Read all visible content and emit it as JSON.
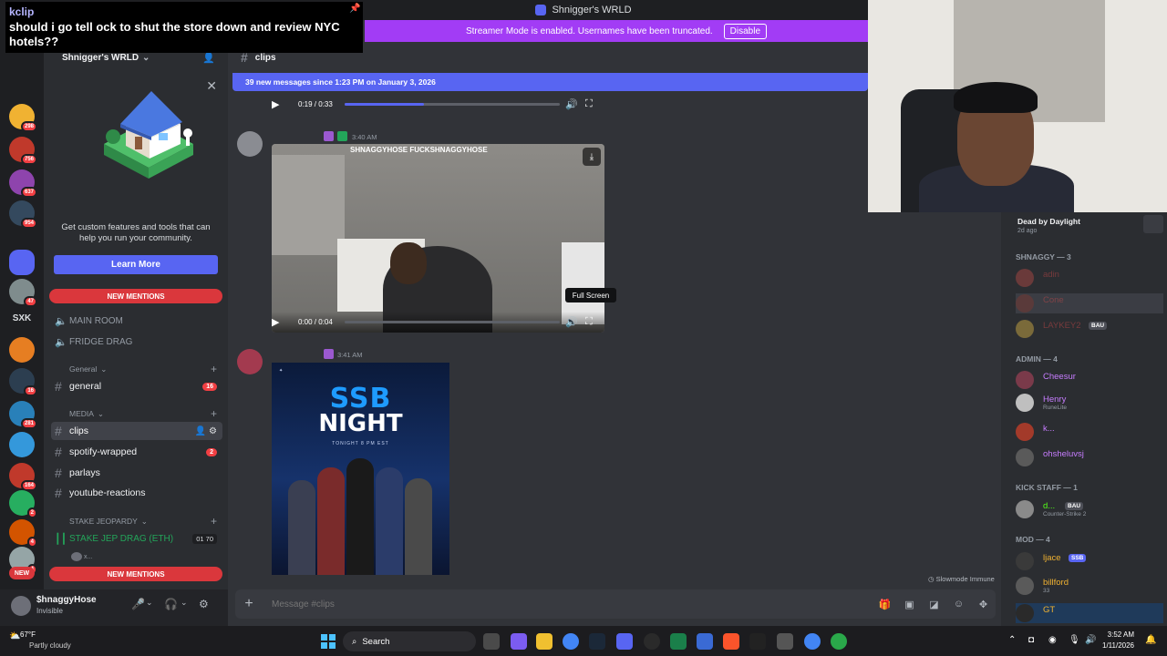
{
  "window": {
    "title": "Shnigger's WRLD"
  },
  "banner": {
    "text": "Streamer Mode is enabled. Usernames have been truncated.",
    "button": "Disable"
  },
  "overlay": {
    "user": "kclip",
    "message": "should i go tell ock to shut the store down and review NYC hotels??"
  },
  "server": {
    "name": "Shnigger's WRLD"
  },
  "rail": {
    "badges": [
      "298",
      "756",
      "637",
      "954",
      "47",
      "16",
      "281",
      "164",
      "2",
      "4",
      "4"
    ],
    "text_item": "SXK",
    "new_label": "NEW"
  },
  "promo": {
    "text": "Get custom features and tools that can help you run your community.",
    "button": "Learn More"
  },
  "sidebar": {
    "new_mentions": "NEW MENTIONS",
    "voice_top": [
      "MAIN ROOM",
      "FRIDGE DRAG"
    ],
    "cat_general": "General",
    "general": {
      "name": "general",
      "count": "16"
    },
    "cat_media": "MEDIA",
    "channels": [
      {
        "name": "clips"
      },
      {
        "name": "spotify-wrapped",
        "count": "2"
      },
      {
        "name": "parlays"
      },
      {
        "name": "youtube-reactions"
      }
    ],
    "cat_stake": "STAKE JEOPARDY",
    "stake_voice": {
      "name": "STAKE JEP DRAG (ETH)",
      "n1": "01",
      "n2": "70"
    },
    "stake_user": "x..."
  },
  "user": {
    "name": "$hnaggyHose",
    "status": "Invisible"
  },
  "chat": {
    "channel": "clips",
    "new_messages": "39 new messages since 1:23 PM on January 3, 2026",
    "video1": {
      "time": "0:19 / 0:33",
      "progress": 0.37
    },
    "msg1": {
      "time": "3:40 AM",
      "watermark": "SHNAGGYHOSE  FUCKSHNAGGYHOSE"
    },
    "video2": {
      "time": "0:00 / 0:04",
      "progress": 0.0
    },
    "tooltip": "Full Screen",
    "msg2": {
      "time": "3:41 AM"
    },
    "poster": {
      "line1": "SSB",
      "line2": "NIGHT",
      "sub": "TONIGHT 8 PM EST"
    },
    "slowmode": "Slowmode Immune",
    "placeholder": "Message #clips"
  },
  "members": {
    "game": {
      "title": "Dead by Daylight",
      "time": "2d ago"
    },
    "roles": [
      {
        "name": "SHNAGGY — 3"
      },
      {
        "name": "ADMIN — 4"
      },
      {
        "name": "KICK STAFF — 1"
      },
      {
        "name": "MOD — 4"
      }
    ],
    "shnaggy": [
      {
        "name": "adin",
        "color": "#d44a4a"
      },
      {
        "name": "Cone",
        "color": "#d44a4a"
      },
      {
        "name": "LAYKEY2",
        "color": "#d44a4a",
        "tag": "BAU"
      }
    ],
    "admin": [
      {
        "name": "Cheesur",
        "color": "#c77dff"
      },
      {
        "name": "Henry",
        "color": "#c77dff",
        "activity": "RuneLite"
      },
      {
        "name": "k...",
        "color": "#c77dff"
      },
      {
        "name": "ohsheluvsj",
        "color": "#c77dff"
      }
    ],
    "kick": [
      {
        "name": "d...",
        "color": "#53fc18",
        "tag": "BAU",
        "activity": "Counter-Strike 2"
      }
    ],
    "mod": [
      {
        "name": "ljace",
        "color": "#f0b232",
        "tag": "SSB"
      },
      {
        "name": "billford",
        "color": "#f0b232",
        "activity": "33"
      },
      {
        "name": "GT",
        "color": "#f0b232"
      }
    ]
  },
  "taskbar": {
    "temp": "67°F",
    "weather": "Partly cloudy",
    "search": "Search",
    "time": "3:52 AM",
    "date": "1/11/2026"
  }
}
